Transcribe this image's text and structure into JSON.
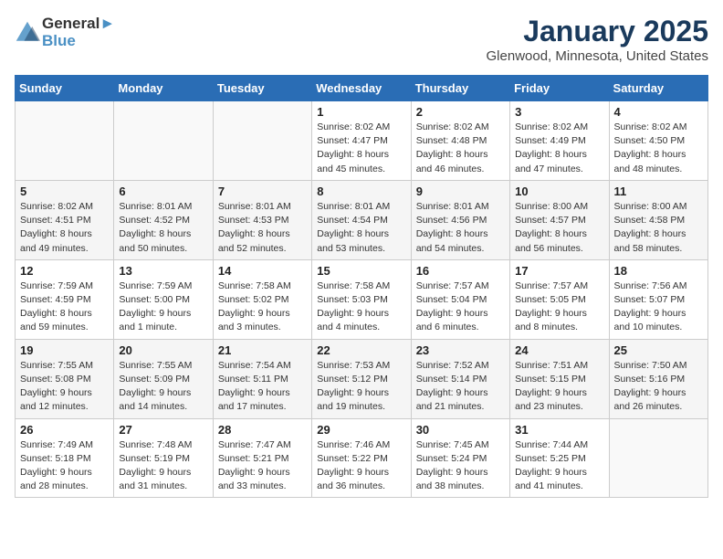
{
  "header": {
    "logo_line1": "General",
    "logo_line2": "Blue",
    "month": "January 2025",
    "location": "Glenwood, Minnesota, United States"
  },
  "weekdays": [
    "Sunday",
    "Monday",
    "Tuesday",
    "Wednesday",
    "Thursday",
    "Friday",
    "Saturday"
  ],
  "weeks": [
    [
      {
        "day": "",
        "info": ""
      },
      {
        "day": "",
        "info": ""
      },
      {
        "day": "",
        "info": ""
      },
      {
        "day": "1",
        "info": "Sunrise: 8:02 AM\nSunset: 4:47 PM\nDaylight: 8 hours\nand 45 minutes."
      },
      {
        "day": "2",
        "info": "Sunrise: 8:02 AM\nSunset: 4:48 PM\nDaylight: 8 hours\nand 46 minutes."
      },
      {
        "day": "3",
        "info": "Sunrise: 8:02 AM\nSunset: 4:49 PM\nDaylight: 8 hours\nand 47 minutes."
      },
      {
        "day": "4",
        "info": "Sunrise: 8:02 AM\nSunset: 4:50 PM\nDaylight: 8 hours\nand 48 minutes."
      }
    ],
    [
      {
        "day": "5",
        "info": "Sunrise: 8:02 AM\nSunset: 4:51 PM\nDaylight: 8 hours\nand 49 minutes."
      },
      {
        "day": "6",
        "info": "Sunrise: 8:01 AM\nSunset: 4:52 PM\nDaylight: 8 hours\nand 50 minutes."
      },
      {
        "day": "7",
        "info": "Sunrise: 8:01 AM\nSunset: 4:53 PM\nDaylight: 8 hours\nand 52 minutes."
      },
      {
        "day": "8",
        "info": "Sunrise: 8:01 AM\nSunset: 4:54 PM\nDaylight: 8 hours\nand 53 minutes."
      },
      {
        "day": "9",
        "info": "Sunrise: 8:01 AM\nSunset: 4:56 PM\nDaylight: 8 hours\nand 54 minutes."
      },
      {
        "day": "10",
        "info": "Sunrise: 8:00 AM\nSunset: 4:57 PM\nDaylight: 8 hours\nand 56 minutes."
      },
      {
        "day": "11",
        "info": "Sunrise: 8:00 AM\nSunset: 4:58 PM\nDaylight: 8 hours\nand 58 minutes."
      }
    ],
    [
      {
        "day": "12",
        "info": "Sunrise: 7:59 AM\nSunset: 4:59 PM\nDaylight: 8 hours\nand 59 minutes."
      },
      {
        "day": "13",
        "info": "Sunrise: 7:59 AM\nSunset: 5:00 PM\nDaylight: 9 hours\nand 1 minute."
      },
      {
        "day": "14",
        "info": "Sunrise: 7:58 AM\nSunset: 5:02 PM\nDaylight: 9 hours\nand 3 minutes."
      },
      {
        "day": "15",
        "info": "Sunrise: 7:58 AM\nSunset: 5:03 PM\nDaylight: 9 hours\nand 4 minutes."
      },
      {
        "day": "16",
        "info": "Sunrise: 7:57 AM\nSunset: 5:04 PM\nDaylight: 9 hours\nand 6 minutes."
      },
      {
        "day": "17",
        "info": "Sunrise: 7:57 AM\nSunset: 5:05 PM\nDaylight: 9 hours\nand 8 minutes."
      },
      {
        "day": "18",
        "info": "Sunrise: 7:56 AM\nSunset: 5:07 PM\nDaylight: 9 hours\nand 10 minutes."
      }
    ],
    [
      {
        "day": "19",
        "info": "Sunrise: 7:55 AM\nSunset: 5:08 PM\nDaylight: 9 hours\nand 12 minutes."
      },
      {
        "day": "20",
        "info": "Sunrise: 7:55 AM\nSunset: 5:09 PM\nDaylight: 9 hours\nand 14 minutes."
      },
      {
        "day": "21",
        "info": "Sunrise: 7:54 AM\nSunset: 5:11 PM\nDaylight: 9 hours\nand 17 minutes."
      },
      {
        "day": "22",
        "info": "Sunrise: 7:53 AM\nSunset: 5:12 PM\nDaylight: 9 hours\nand 19 minutes."
      },
      {
        "day": "23",
        "info": "Sunrise: 7:52 AM\nSunset: 5:14 PM\nDaylight: 9 hours\nand 21 minutes."
      },
      {
        "day": "24",
        "info": "Sunrise: 7:51 AM\nSunset: 5:15 PM\nDaylight: 9 hours\nand 23 minutes."
      },
      {
        "day": "25",
        "info": "Sunrise: 7:50 AM\nSunset: 5:16 PM\nDaylight: 9 hours\nand 26 minutes."
      }
    ],
    [
      {
        "day": "26",
        "info": "Sunrise: 7:49 AM\nSunset: 5:18 PM\nDaylight: 9 hours\nand 28 minutes."
      },
      {
        "day": "27",
        "info": "Sunrise: 7:48 AM\nSunset: 5:19 PM\nDaylight: 9 hours\nand 31 minutes."
      },
      {
        "day": "28",
        "info": "Sunrise: 7:47 AM\nSunset: 5:21 PM\nDaylight: 9 hours\nand 33 minutes."
      },
      {
        "day": "29",
        "info": "Sunrise: 7:46 AM\nSunset: 5:22 PM\nDaylight: 9 hours\nand 36 minutes."
      },
      {
        "day": "30",
        "info": "Sunrise: 7:45 AM\nSunset: 5:24 PM\nDaylight: 9 hours\nand 38 minutes."
      },
      {
        "day": "31",
        "info": "Sunrise: 7:44 AM\nSunset: 5:25 PM\nDaylight: 9 hours\nand 41 minutes."
      },
      {
        "day": "",
        "info": ""
      }
    ]
  ]
}
